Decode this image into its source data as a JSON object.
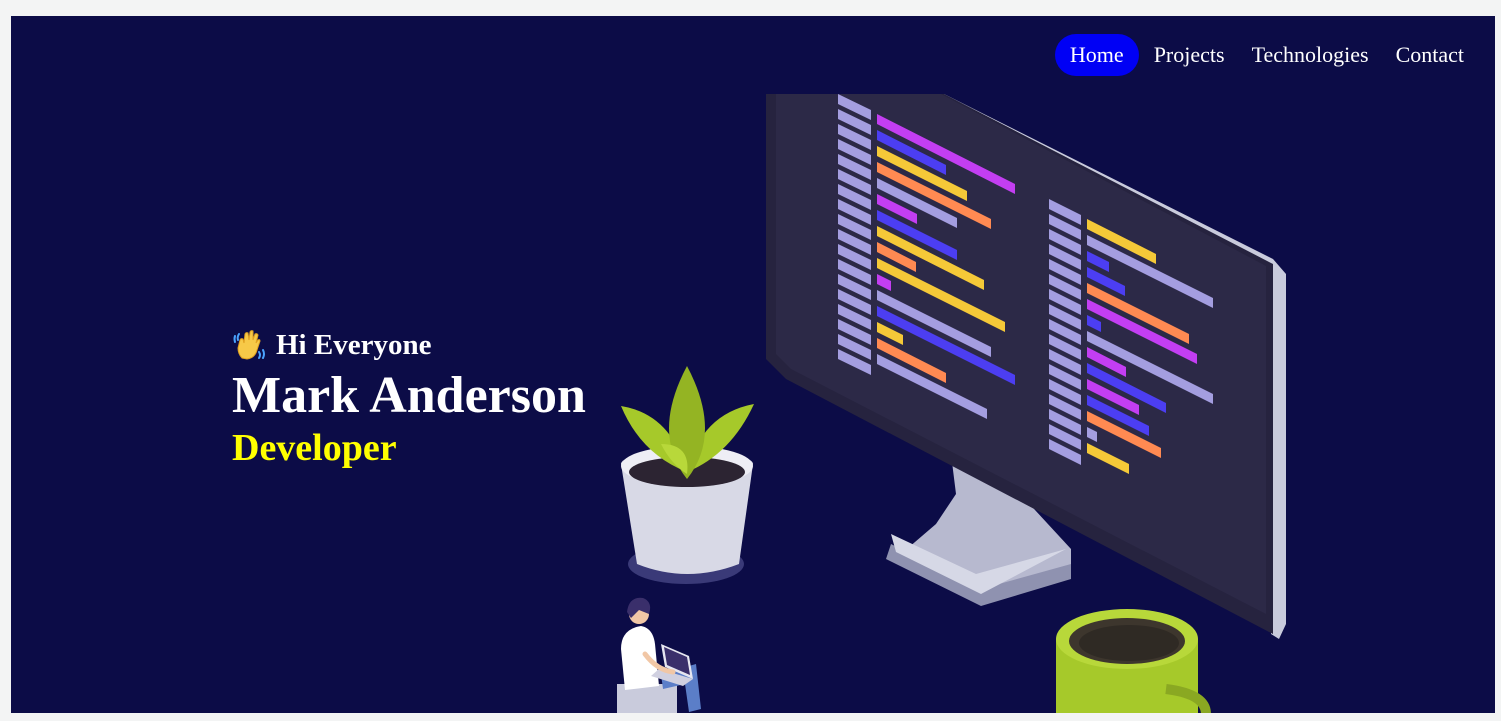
{
  "nav": {
    "items": [
      {
        "label": "Home",
        "active": true
      },
      {
        "label": "Projects",
        "active": false
      },
      {
        "label": "Technologies",
        "active": false
      },
      {
        "label": "Contact",
        "active": false
      }
    ],
    "active_color": "#0000f5"
  },
  "hero": {
    "greeting_icon": "waving-hand-icon",
    "greeting": "Hi Everyone",
    "name": "Mark Anderson",
    "role": "Developer",
    "role_color": "#ffff00"
  },
  "colors": {
    "background": "#0c0c47",
    "page_bg": "#f3f4f4"
  },
  "illustration": {
    "icons": [
      "monitor-icon",
      "code-lines-icon",
      "plant-pot-icon",
      "coffee-mug-icon",
      "person-laptop-icon"
    ]
  }
}
